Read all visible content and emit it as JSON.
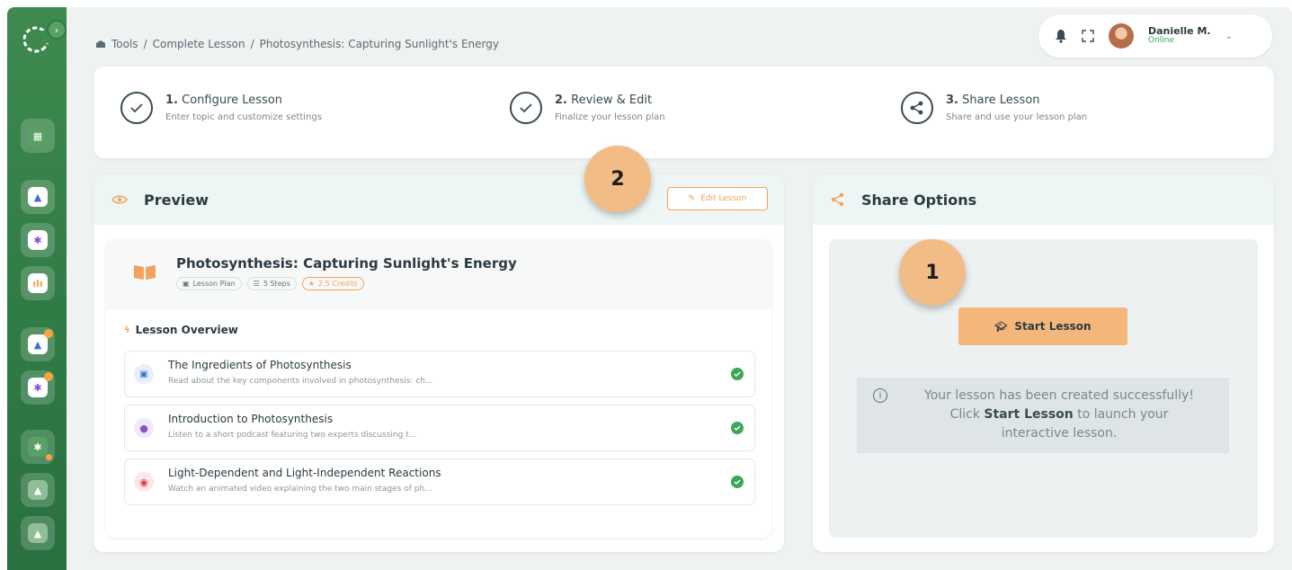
{
  "breadcrumb": {
    "items": [
      "Tools",
      "Complete Lesson",
      "Photosynthesis: Capturing Sunlight's Energy"
    ],
    "separator": "/"
  },
  "user": {
    "name": "Danielle M.",
    "status": "Online"
  },
  "steps": [
    {
      "number": "1.",
      "title": "Configure Lesson",
      "subtitle": "Enter topic and customize settings"
    },
    {
      "number": "2.",
      "title": "Review & Edit",
      "subtitle": "Finalize your lesson plan"
    },
    {
      "number": "3.",
      "title": "Share Lesson",
      "subtitle": "Share and use your lesson plan"
    }
  ],
  "preview": {
    "title": "Preview",
    "edit_label": "Edit Lesson",
    "lesson_title": "Photosynthesis: Capturing Sunlight's Energy",
    "chips": {
      "type": "Lesson Plan",
      "steps": "5 Steps",
      "credits": "2.5 Credits"
    },
    "overview_label": "Lesson Overview",
    "activities": [
      {
        "title": "The Ingredients of Photosynthesis",
        "desc": "Read about the key components involved in photosynthesis: ch...",
        "icon": "book-icon",
        "color": "#3b6fd6"
      },
      {
        "title": "Introduction to Photosynthesis",
        "desc": "Listen to a short podcast featuring two experts discussing t...",
        "icon": "microphone-icon",
        "color": "#8a4fd1"
      },
      {
        "title": "Light-Dependent and Light-Independent Reactions",
        "desc": "Watch an animated video explaining the two main stages of ph...",
        "icon": "video-icon",
        "color": "#e03a3a"
      }
    ]
  },
  "share": {
    "title": "Share Options",
    "start_label": "Start Lesson",
    "info_line1": "Your lesson has been created successfully!",
    "info_click": "Click",
    "info_bold": "Start Lesson",
    "info_rest": "to launch your",
    "info_line3": "interactive lesson."
  },
  "annotations": {
    "badge1": "1",
    "badge2": "2"
  },
  "colors": {
    "accent": "#f2a25a",
    "sidebar": "#2f7a45",
    "success": "#3aa757",
    "badge": "#f2bc87"
  }
}
